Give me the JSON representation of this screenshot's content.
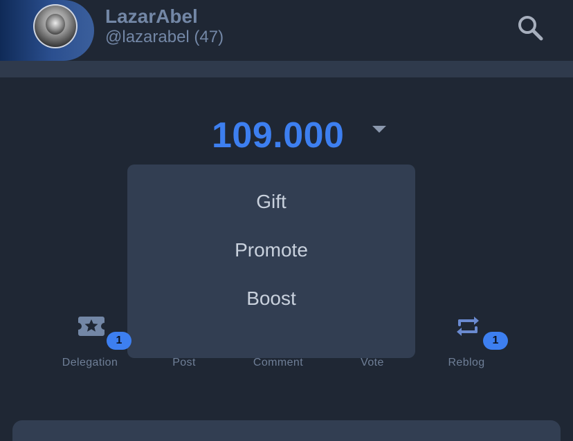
{
  "header": {
    "username": "LazarAbel",
    "handle": "@lazarabel (47)"
  },
  "value_selector": {
    "value": "109.000"
  },
  "menu": {
    "items": [
      "Gift",
      "Promote",
      "Boost"
    ]
  },
  "stats": [
    {
      "label": "Delegation",
      "badge": "1",
      "icon": "ticket-star-icon"
    },
    {
      "label": "Post",
      "badge": "",
      "icon": ""
    },
    {
      "label": "Comment",
      "badge": "",
      "icon": ""
    },
    {
      "label": "Vote",
      "badge": "",
      "icon": ""
    },
    {
      "label": "Reblog",
      "badge": "1",
      "icon": "repeat-icon"
    }
  ],
  "colors": {
    "accent": "#3d7ff0",
    "text_muted": "#7387a6",
    "menu_bg": "#323e52"
  }
}
